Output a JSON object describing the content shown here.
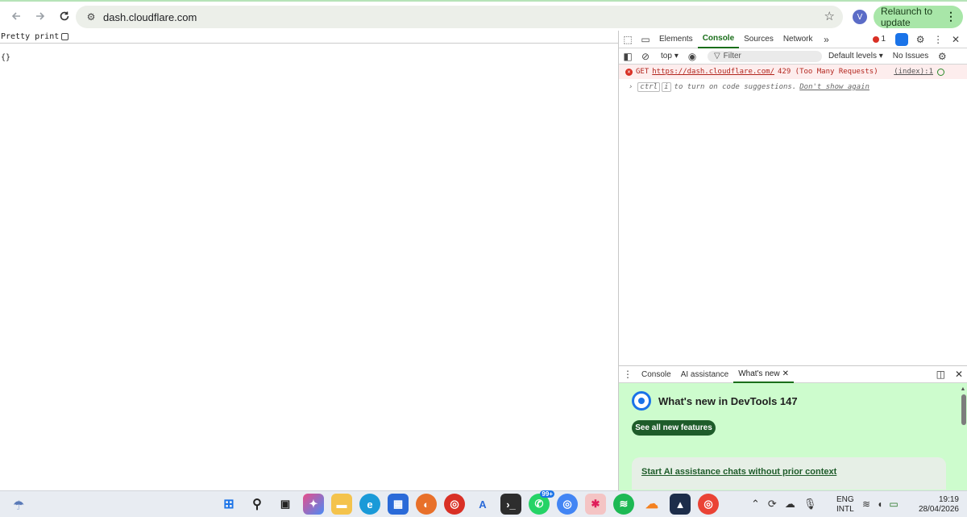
{
  "browser": {
    "url": "dash.cloudflare.com",
    "avatar_letter": "V",
    "relaunch_label": "Relaunch to update",
    "back_icon": "arrow-left-icon",
    "forward_icon": "arrow-right-icon",
    "reload_icon": "reload-icon"
  },
  "page": {
    "pretty_print_label": "Pretty print",
    "json_body": "{}"
  },
  "devtools": {
    "tabs": [
      "Elements",
      "Console",
      "Sources",
      "Network"
    ],
    "active_tab": "Console",
    "error_count": "1",
    "context": "top",
    "filter_placeholder": "Filter",
    "levels": "Default levels",
    "issues": "No Issues",
    "message": {
      "method": "GET",
      "url": "https://dash.cloudflare.com/",
      "status": "429 (Too Many Requests)",
      "source": "(index):1"
    },
    "prompt": {
      "key1": "ctrl",
      "key2": "i",
      "hint": "to turn on code suggestions.",
      "dismiss": "Don't show again"
    },
    "drawer": {
      "tabs": [
        "Console",
        "AI assistance",
        "What's new"
      ],
      "active_tab": "What's new",
      "title": "What's new in DevTools 147",
      "button": "See all new features",
      "card_title": "Start AI assistance chats without prior context"
    }
  },
  "taskbar": {
    "lang_line1": "ENG",
    "lang_line2": "INTL",
    "time": "19:19",
    "date": "28/04/2026",
    "whatsapp_badge": "99+"
  },
  "colors": {
    "accent_green": "#1a6e1a",
    "error_red": "#d93025",
    "whatsnew_bg": "#cdfccd",
    "relaunch_bg": "#a8e6a8"
  }
}
